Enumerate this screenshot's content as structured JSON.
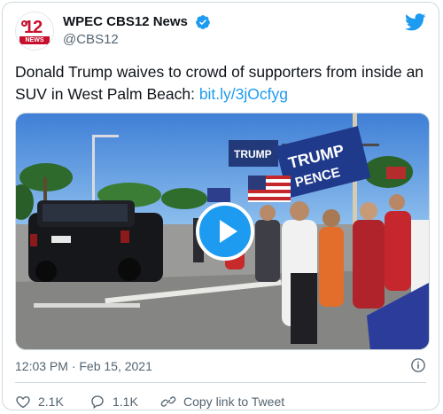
{
  "account": {
    "display_name": "WPEC CBS12 News",
    "handle": "@CBS12",
    "avatar_logo_number": "12",
    "avatar_logo_word": "NEWS",
    "verified": true
  },
  "tweet": {
    "text": "Donald Trump waives to crowd of supporters from inside an SUV in West Palm Beach: ",
    "link": "bit.ly/3jOcfyg"
  },
  "media": {
    "type": "video",
    "flag_text_1": "TRUMP",
    "flag_text_2": "TRUMP",
    "flag_text_3": "PENCE"
  },
  "meta": {
    "timestamp": "12:03 PM · Feb 15, 2021"
  },
  "actions": {
    "likes": "2.1K",
    "replies": "1.1K",
    "copy_link": "Copy link to Tweet"
  },
  "colors": {
    "accent": "#1d9bf0",
    "brand_red": "#c8102e",
    "muted_text": "#536471"
  },
  "icons": [
    "verified-badge-icon",
    "twitter-bird-icon",
    "play-icon",
    "info-icon",
    "heart-icon",
    "reply-icon",
    "link-icon"
  ]
}
